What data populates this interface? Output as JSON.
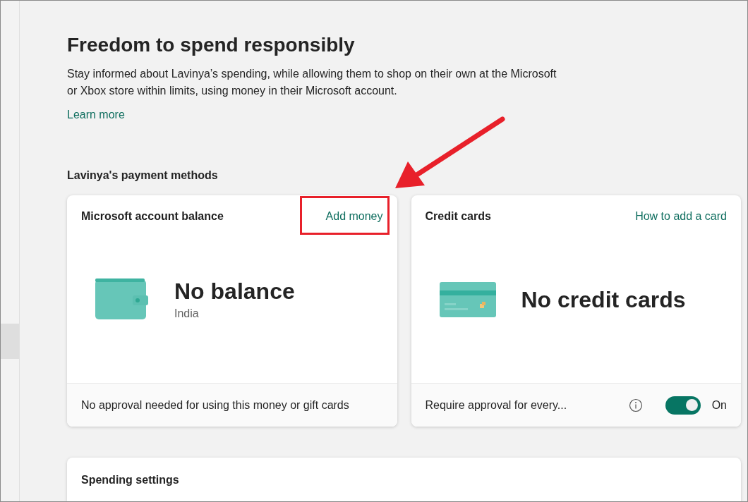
{
  "heading": "Freedom to spend responsibly",
  "description": "Stay informed about Lavinya’s spending, while allowing them to shop on their own at the Microsoft or Xbox store within limits, using money in their Microsoft account.",
  "learn_more": "Learn more",
  "payment_methods": {
    "title": "Lavinya's payment methods",
    "cards": [
      {
        "kind": "balance",
        "title": "Microsoft account balance",
        "link": "Add money",
        "highlighted": true,
        "main": "No balance",
        "sub": "India",
        "footer": "No approval needed for using this money or gift cards"
      },
      {
        "kind": "credit",
        "title": "Credit cards",
        "link": "How to add a card",
        "highlighted": false,
        "main": "No credit cards",
        "footer": "Require approval for every...",
        "toggle": {
          "on": true,
          "label": "On"
        }
      }
    ]
  },
  "spending_settings": {
    "title": "Spending settings"
  }
}
